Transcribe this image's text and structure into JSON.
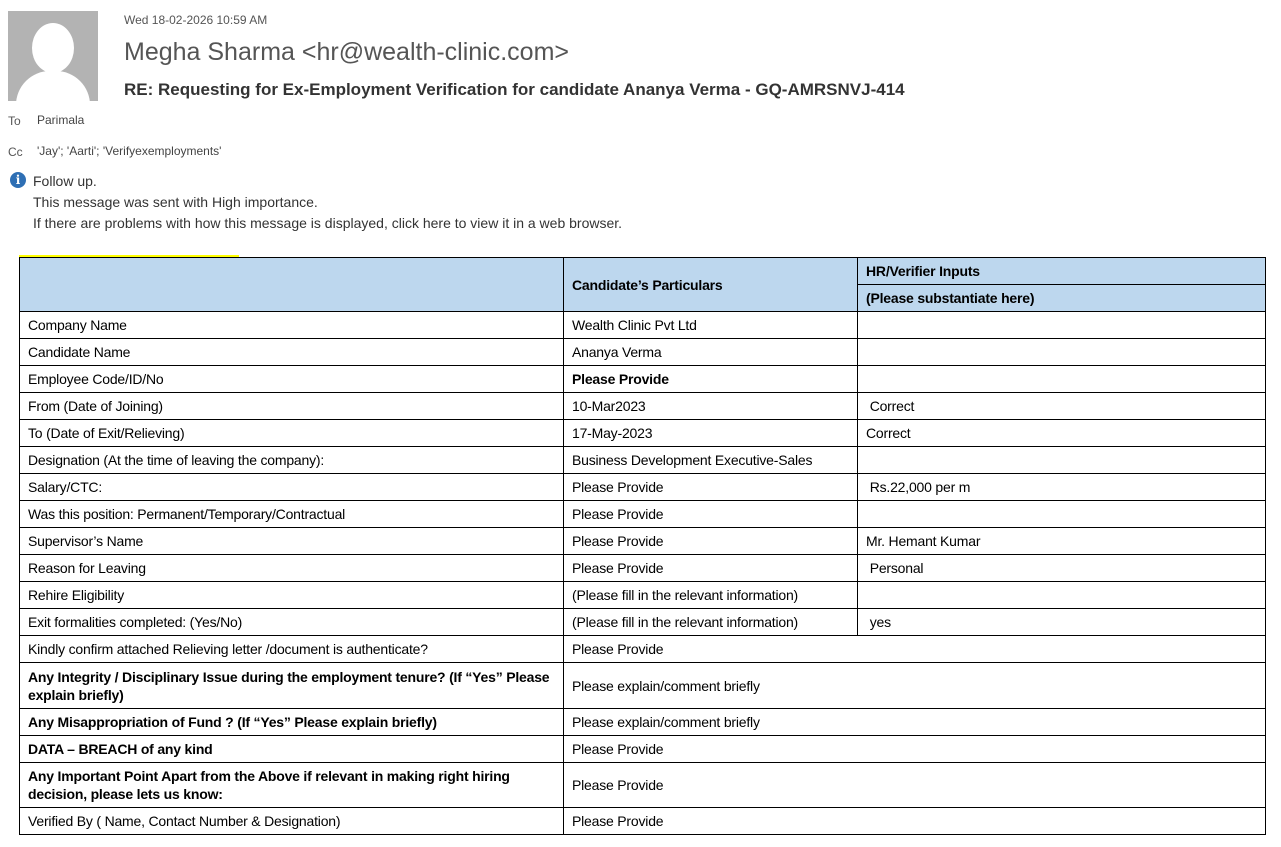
{
  "header": {
    "date": "Wed 18-02-2026 10:59 AM",
    "from": "Megha Sharma <hr@wealth-clinic.com>",
    "subject": "RE: Requesting for Ex-Employment Verification for candidate Ananya Verma - GQ-AMRSNVJ-414",
    "to_label": "To",
    "to": "Parimala",
    "cc_label": "Cc",
    "cc": "'Jay'; 'Aarti'; 'Verifyexemployments'"
  },
  "notices": {
    "icon": "info-icon",
    "followup": "Follow up.",
    "importance": "This message was sent with High importance.",
    "display": "If there are problems with how this message is displayed, click here to view it in a web browser."
  },
  "table": {
    "header": {
      "col2": "Candidate’s Particulars",
      "col3a": "HR/Verifier Inputs",
      "col3b": "(Please substantiate here)"
    },
    "rows": [
      {
        "label": "Company Name",
        "value": "Wealth Clinic Pvt Ltd",
        "input": ""
      },
      {
        "label": "Candidate Name",
        "value": "Ananya Verma",
        "input": ""
      },
      {
        "label": "Employee Code/ID/No",
        "value": "Please Provide",
        "input": ""
      },
      {
        "label": "From (Date of Joining)",
        "value": "10-Mar2023",
        "input": " Correct"
      },
      {
        "label": "To (Date of Exit/Relieving)",
        "value": "17-May-2023",
        "input": "Correct"
      },
      {
        "label": "Designation (At the time of leaving the company):",
        "value": "Business Development Executive-Sales",
        "input": ""
      },
      {
        "label": "Salary/CTC:",
        "value": "Please Provide",
        "input": " Rs.22,000 per m"
      },
      {
        "label": "Was this position: Permanent/Temporary/Contractual",
        "value": "Please Provide",
        "input": ""
      },
      {
        "label": "Supervisor’s Name",
        "value": "Please Provide",
        "input": "Mr. Hemant Kumar"
      },
      {
        "label": "Reason for Leaving",
        "value": "Please Provide",
        "input": " Personal"
      },
      {
        "label": "Rehire Eligibility",
        "value": "(Please fill in the relevant information)",
        "input": ""
      },
      {
        "label": "Exit formalities completed: (Yes/No)",
        "value": "(Please fill in the relevant information)",
        "input": " yes"
      }
    ],
    "wide_rows": [
      {
        "label": "Kindly confirm attached Relieving letter /document is authenticate?",
        "value": "Please Provide"
      },
      {
        "label": "Any Integrity / Disciplinary Issue during the employment tenure? (If “Yes” Please explain briefly)",
        "value": "Please explain/comment briefly"
      },
      {
        "label": "Any Misappropriation of Fund ? (If “Yes” Please explain briefly)",
        "value": "Please explain/comment briefly"
      },
      {
        "label": "DATA – BREACH of any kind",
        "value": "Please Provide"
      },
      {
        "label": "Any Important Point Apart from the Above if relevant in making right hiring decision, please lets us know:",
        "value": "Please Provide"
      },
      {
        "label": "Verified By ( Name, Contact Number & Designation)",
        "value": "Please Provide"
      }
    ]
  }
}
